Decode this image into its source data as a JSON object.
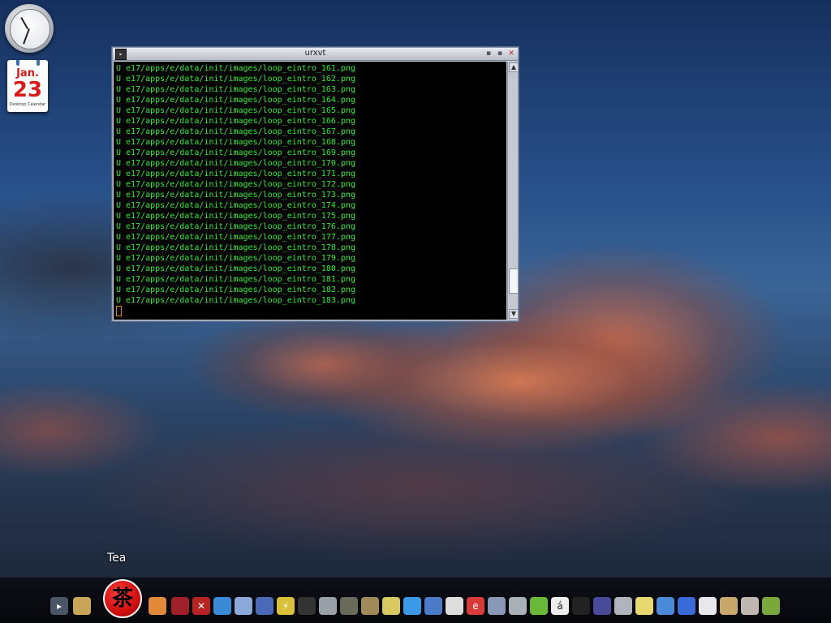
{
  "desktop": {
    "calendar": {
      "month": "Jan.",
      "day": "23",
      "caption": "Desktop Calendar"
    },
    "launcher_label": "Tea"
  },
  "window": {
    "title": "urxvt",
    "terminal_lines": [
      "U e17/apps/e/data/init/images/loop_eintro_161.png",
      "U e17/apps/e/data/init/images/loop_eintro_162.png",
      "U e17/apps/e/data/init/images/loop_eintro_163.png",
      "U e17/apps/e/data/init/images/loop_eintro_164.png",
      "U e17/apps/e/data/init/images/loop_eintro_165.png",
      "U e17/apps/e/data/init/images/loop_eintro_166.png",
      "U e17/apps/e/data/init/images/loop_eintro_167.png",
      "U e17/apps/e/data/init/images/loop_eintro_168.png",
      "U e17/apps/e/data/init/images/loop_eintro_169.png",
      "U e17/apps/e/data/init/images/loop_eintro_170.png",
      "U e17/apps/e/data/init/images/loop_eintro_171.png",
      "U e17/apps/e/data/init/images/loop_eintro_172.png",
      "U e17/apps/e/data/init/images/loop_eintro_173.png",
      "U e17/apps/e/data/init/images/loop_eintro_174.png",
      "U e17/apps/e/data/init/images/loop_eintro_175.png",
      "U e17/apps/e/data/init/images/loop_eintro_176.png",
      "U e17/apps/e/data/init/images/loop_eintro_177.png",
      "U e17/apps/e/data/init/images/loop_eintro_178.png",
      "U e17/apps/e/data/init/images/loop_eintro_179.png",
      "U e17/apps/e/data/init/images/loop_eintro_180.png",
      "U e17/apps/e/data/init/images/loop_eintro_181.png",
      "U e17/apps/e/data/init/images/loop_eintro_182.png",
      "U e17/apps/e/data/init/images/loop_eintro_183.png"
    ],
    "scroll_position": 0.92,
    "scroll_visible_fraction": 0.1,
    "colors": {
      "terminal_text": "#2cf02c",
      "terminal_bg": "#000000",
      "cursor": "#e08a1e",
      "close": "#c0202a"
    }
  },
  "dock": {
    "tea_glyph": "茶",
    "items": [
      {
        "name": "terminal-icon",
        "color": "#4a5566",
        "glyph": "▸"
      },
      {
        "name": "floppy-save-icon",
        "color": "#c9a55a",
        "glyph": ""
      },
      {
        "name": "tea-launcher-icon",
        "color": "#d01010",
        "glyph": ""
      },
      {
        "name": "shell-icon",
        "color": "#e38a3a",
        "glyph": ""
      },
      {
        "name": "record-icon",
        "color": "#a0202a",
        "glyph": ""
      },
      {
        "name": "x-tools-icon",
        "color": "#b82424",
        "glyph": "✕"
      },
      {
        "name": "chat-bubble-icon",
        "color": "#3a8ad8",
        "glyph": ""
      },
      {
        "name": "joystick-icon",
        "color": "#8aa8d8",
        "glyph": ""
      },
      {
        "name": "rocket-icon",
        "color": "#4a6ab8",
        "glyph": ""
      },
      {
        "name": "lightning-icon",
        "color": "#d8c03a",
        "glyph": "⚡"
      },
      {
        "name": "clapperboard-icon",
        "color": "#333333",
        "glyph": ""
      },
      {
        "name": "robot-icon",
        "color": "#9aa0a8",
        "glyph": ""
      },
      {
        "name": "bird-icon",
        "color": "#6a6a5a",
        "glyph": ""
      },
      {
        "name": "ball-icon",
        "color": "#a08a5a",
        "glyph": ""
      },
      {
        "name": "penguin-icon",
        "color": "#d8c860",
        "glyph": ""
      },
      {
        "name": "water-drop-icon",
        "color": "#3a9ae8",
        "glyph": ""
      },
      {
        "name": "books-icon",
        "color": "#4a7ac8",
        "glyph": ""
      },
      {
        "name": "speech-icon",
        "color": "#dddddd",
        "glyph": ""
      },
      {
        "name": "email-e-icon",
        "color": "#d83a3a",
        "glyph": "e"
      },
      {
        "name": "camera-icon",
        "color": "#8a98b8",
        "glyph": ""
      },
      {
        "name": "printer-icon",
        "color": "#aab0b8",
        "glyph": ""
      },
      {
        "name": "user-icon",
        "color": "#6ab83a",
        "glyph": ""
      },
      {
        "name": "character-map-icon",
        "color": "#eeeeee",
        "glyph": "á"
      },
      {
        "name": "bomb-icon",
        "color": "#222222",
        "glyph": ""
      },
      {
        "name": "moon-icon",
        "color": "#4a4a9a",
        "glyph": ""
      },
      {
        "name": "calculator-icon",
        "color": "#b0b4bc",
        "glyph": ""
      },
      {
        "name": "notes-icon",
        "color": "#e8d870",
        "glyph": ""
      },
      {
        "name": "cube-icon",
        "color": "#4a8ad8",
        "glyph": ""
      },
      {
        "name": "check-icon",
        "color": "#3a6ad8",
        "glyph": ""
      },
      {
        "name": "disc-icon",
        "color": "#e8e8ec",
        "glyph": ""
      },
      {
        "name": "web-icon",
        "color": "#c8a86a",
        "glyph": ""
      },
      {
        "name": "tools-icon",
        "color": "#c0b8b0",
        "glyph": ""
      },
      {
        "name": "book-icon",
        "color": "#7aa83a",
        "glyph": ""
      }
    ]
  }
}
